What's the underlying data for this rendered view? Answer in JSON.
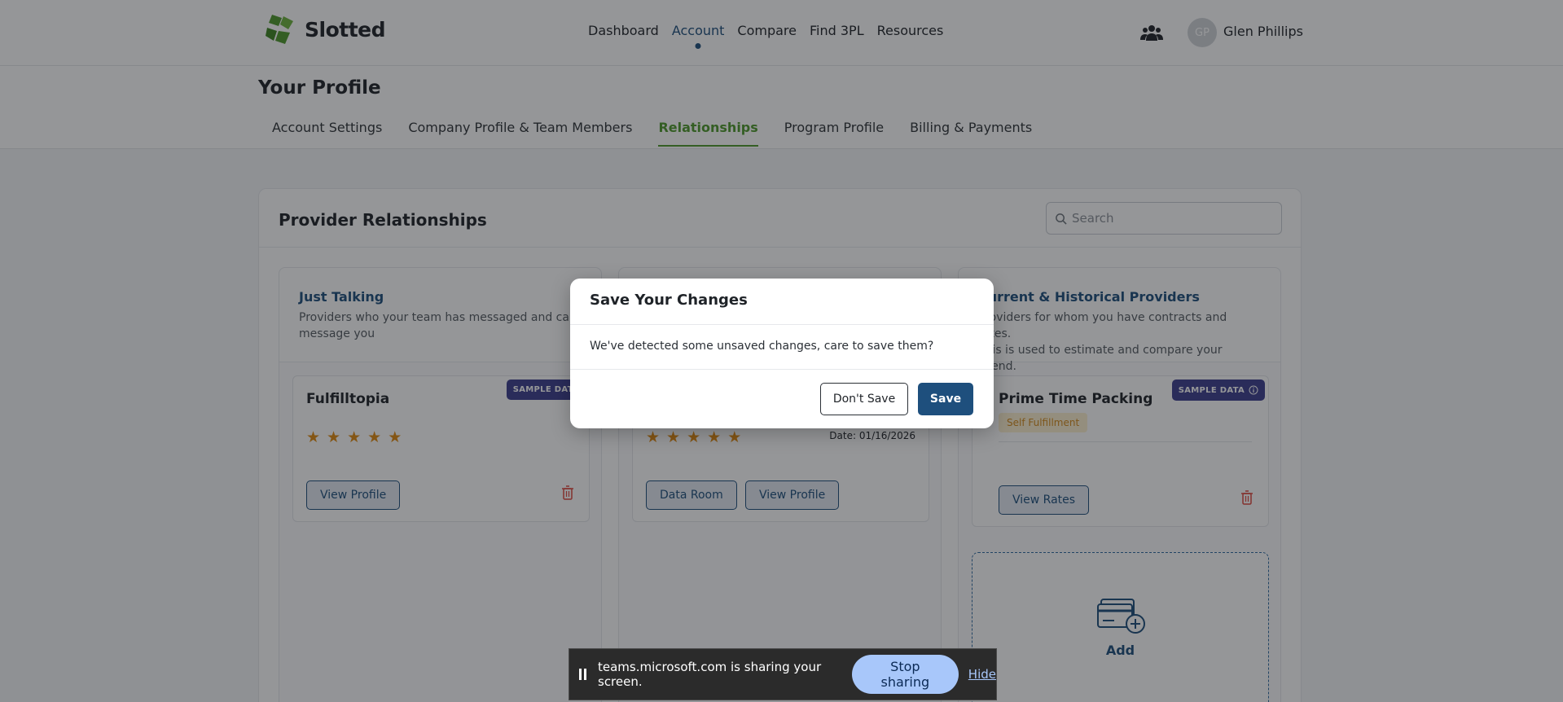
{
  "brand": {
    "name": "Slotted",
    "color": "#4f9a2c"
  },
  "nav": {
    "items": [
      "Dashboard",
      "Account",
      "Compare",
      "Find 3PL",
      "Resources"
    ],
    "active": "Account"
  },
  "user": {
    "initials": "GP",
    "name": "Glen Phillips"
  },
  "profile": {
    "title": "Your Profile",
    "tabs": [
      "Account Settings",
      "Company Profile & Team Members",
      "Relationships",
      "Program Profile",
      "Billing & Payments"
    ],
    "active_tab": "Relationships"
  },
  "panel": {
    "title": "Provider Relationships",
    "search_placeholder": "Search",
    "columns": [
      {
        "title": "Just Talking",
        "desc_line1": "Providers who your team has messaged and can",
        "desc_line2": "message you",
        "card": {
          "name": "Fulfilltopia",
          "badge": "SAMPLE DATA",
          "rating": 5,
          "view_profile": "View Profile"
        }
      },
      {
        "title": "",
        "card": {
          "date": "Date: 01/16/2026",
          "rating": 5,
          "data_room": "Data Room",
          "view_profile": "View Profile"
        }
      },
      {
        "title": "Current & Historical Providers",
        "desc_line1": "Providers for whom you have contracts and rates.",
        "desc_line2": "This is used to estimate and compare your spend.",
        "card": {
          "name": "Prime Time Packing",
          "badge": "SAMPLE DATA",
          "tag": "Self Fulfillment",
          "view_rates": "View Rates"
        },
        "add_label": "Add"
      }
    ]
  },
  "modal": {
    "title": "Save Your Changes",
    "message": "We've detected some unsaved changes, care to save them?",
    "dont_save": "Don't Save",
    "save": "Save"
  },
  "sharebar": {
    "message": "teams.microsoft.com is sharing your screen.",
    "stop": "Stop sharing",
    "hide": "Hide"
  },
  "icons": [
    "logo-icon",
    "team-icon",
    "search-icon",
    "star-icon",
    "trash-icon",
    "info-icon",
    "add-card-icon",
    "pause-icon"
  ]
}
